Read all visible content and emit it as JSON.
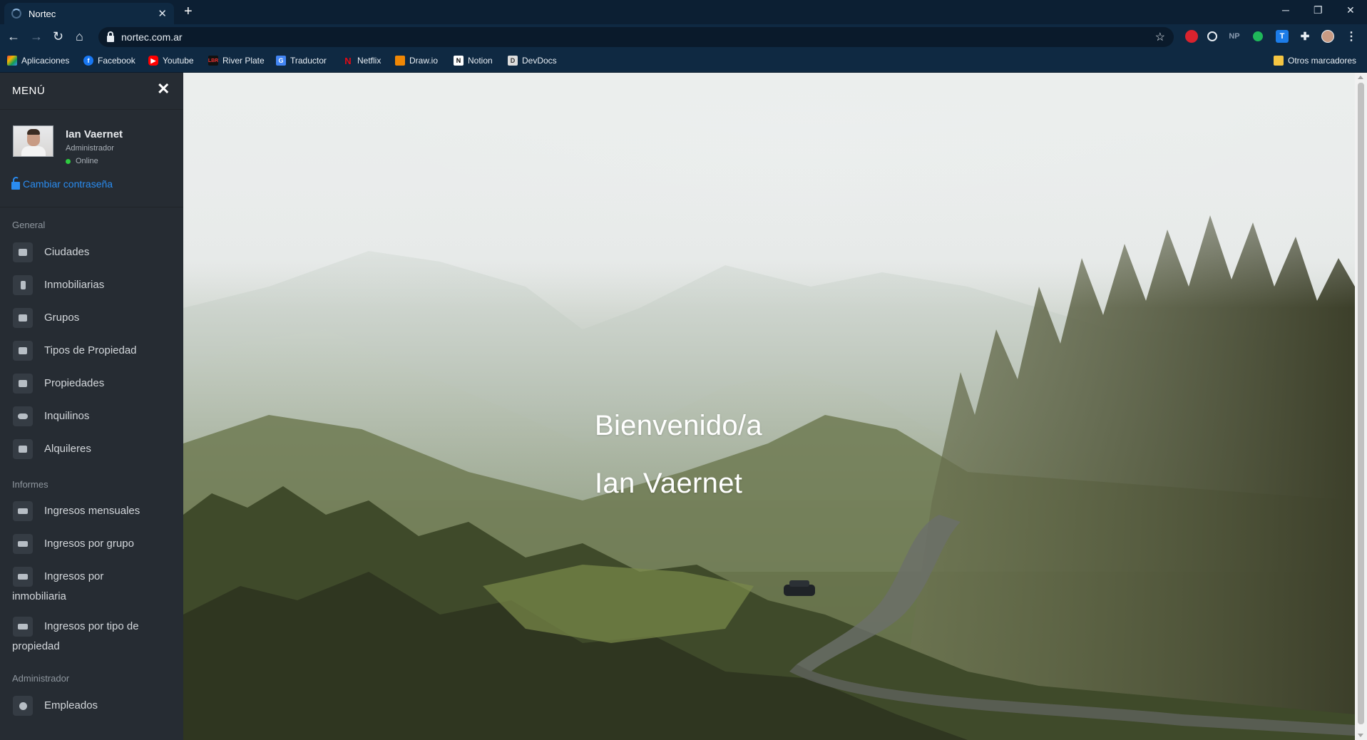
{
  "browser": {
    "tab_title": "Nortec",
    "tab_close": "✕",
    "new_tab": "+",
    "url": "nortec.com.ar",
    "window_controls": {
      "minimize": "─",
      "restore": "❐",
      "close": "✕"
    },
    "extensions": [
      "NP"
    ],
    "bookmarks": [
      {
        "label": "Aplicaciones",
        "icon": "apps-grid-icon",
        "color": "#e8453c"
      },
      {
        "label": "Facebook",
        "icon": "facebook-icon",
        "color": "#1877f2"
      },
      {
        "label": "Youtube",
        "icon": "youtube-icon",
        "color": "#ff0000"
      },
      {
        "label": "River Plate",
        "icon": "river-plate-icon",
        "color": "#111111"
      },
      {
        "label": "Traductor",
        "icon": "translate-icon",
        "color": "#4285f4"
      },
      {
        "label": "Netflix",
        "icon": "netflix-icon",
        "color": "#e50914"
      },
      {
        "label": "Draw.io",
        "icon": "drawio-icon",
        "color": "#f08705"
      },
      {
        "label": "Notion",
        "icon": "notion-icon",
        "color": "#ffffff"
      },
      {
        "label": "DevDocs",
        "icon": "devdocs-icon",
        "color": "#dddddd"
      }
    ],
    "other_bookmarks": "Otros marcadores"
  },
  "sidebar": {
    "title": "MENÚ",
    "close_glyph": "✕",
    "user": {
      "name": "Ian Vaernet",
      "role": "Administrador",
      "status": "Online",
      "status_color": "#2ecc40"
    },
    "change_password": "Cambiar contraseña",
    "sections": [
      {
        "label": "General",
        "items": [
          {
            "label": "Ciudades",
            "icon": "city-icon"
          },
          {
            "label": "Inmobiliarias",
            "icon": "building-icon"
          },
          {
            "label": "Grupos",
            "icon": "group-icon"
          },
          {
            "label": "Tipos de Propiedad",
            "icon": "property-type-icon"
          },
          {
            "label": "Propiedades",
            "icon": "home-icon"
          },
          {
            "label": "Inquilinos",
            "icon": "users-icon"
          },
          {
            "label": "Alquileres",
            "icon": "handshake-icon"
          }
        ]
      },
      {
        "label": "Informes",
        "items": [
          {
            "label": "Ingresos mensuales",
            "icon": "money-icon"
          },
          {
            "label": "Ingresos por grupo",
            "icon": "money-icon"
          },
          {
            "label": "Ingresos por inmobiliaria",
            "icon": "money-icon"
          },
          {
            "label": "Ingresos por tipo de propiedad",
            "icon": "money-icon"
          }
        ]
      },
      {
        "label": "Administrador",
        "items": [
          {
            "label": "Empleados",
            "icon": "user-circle-icon"
          }
        ]
      }
    ]
  },
  "main": {
    "welcome": "Bienvenido/a",
    "user_name": "Ian Vaernet"
  },
  "colors": {
    "sidebar_bg": "#262c33",
    "link": "#2a8cf0",
    "chrome": "#0f2942"
  }
}
